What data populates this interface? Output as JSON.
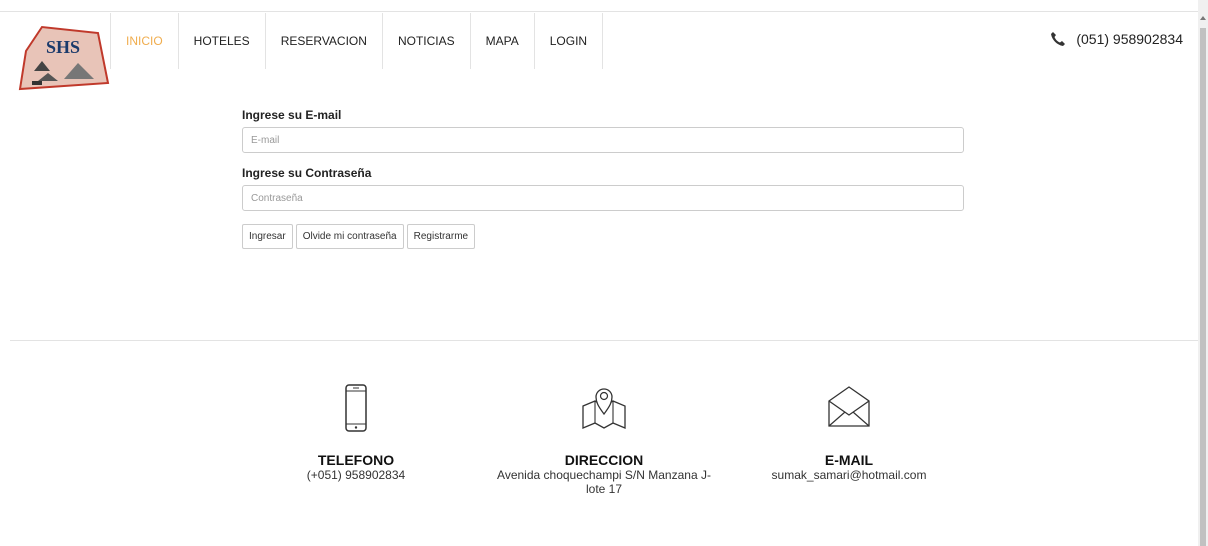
{
  "brand": {
    "logo_text": "SHS"
  },
  "nav": {
    "items": [
      {
        "label": "INICIO",
        "active": true
      },
      {
        "label": "HOTELES"
      },
      {
        "label": "RESERVACION"
      },
      {
        "label": "NOTICIAS"
      },
      {
        "label": "MAPA"
      },
      {
        "label": "LOGIN"
      }
    ],
    "phone": "(051) 958902834"
  },
  "login": {
    "email_label": "Ingrese su E-mail",
    "email_placeholder": "E-mail",
    "email_value": "",
    "password_label": "Ingrese su Contraseña",
    "password_placeholder": "Contraseña",
    "password_value": "",
    "login_button": "Ingresar",
    "forgot_button": "Olvide mi contraseña",
    "register_button": "Registrarme"
  },
  "footer": {
    "phone_title": "TELEFONO",
    "phone_value": "(+051) 958902834",
    "address_title": "DIRECCION",
    "address_value": "Avenida choquechampi S/N Manzana J-lote 17",
    "email_title": "E-MAIL",
    "email_value": "sumak_samari@hotmail.com"
  },
  "colors": {
    "accent": "#f0ad4e",
    "logo_red": "#c0392b",
    "logo_bg": "#e8c4b8"
  }
}
